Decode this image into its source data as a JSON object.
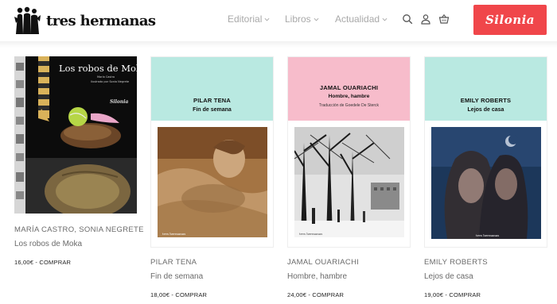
{
  "brand": {
    "name": "tres hermanas",
    "logo_icon": "three-sisters-silhouette"
  },
  "nav": [
    {
      "label": "Editorial"
    },
    {
      "label": "Libros"
    },
    {
      "label": "Actualidad"
    }
  ],
  "header_icons": [
    "search-icon",
    "user-icon",
    "cart-icon"
  ],
  "partner_button": {
    "label": "Silonia",
    "color": "#f0464a"
  },
  "books": [
    {
      "cover_title": "Los robos de Moka",
      "cover_subtitle_1": "María Castro",
      "cover_subtitle_2": "ilustrado por Sonia Negrete",
      "cover_sign": "Silonia",
      "author": "MARÍA CASTRO, SONIA NEGRETE",
      "title": "Los robos de Moka",
      "price": "16,00€ - COMPRAR"
    },
    {
      "cover_author": "PILAR TENA",
      "cover_title": "Fin de semana",
      "cover_color": "#b9e9e1",
      "author": "PILAR TENA",
      "title": "Fin de semana",
      "price": "18,00€ - COMPRAR"
    },
    {
      "cover_author": "JAMAL OUARIACHI",
      "cover_title": "Hombre, hambre",
      "cover_translator": "Traducción de Goedele De Sterck",
      "cover_color": "#f7bccb",
      "author": "JAMAL OUARIACHI",
      "title": "Hombre, hambre",
      "price": "24,00€ - COMPRAR"
    },
    {
      "cover_author": "EMILY ROBERTS",
      "cover_title": "Lejos de casa",
      "cover_color": "#b9e9e1",
      "author": "EMILY ROBERTS",
      "title": "Lejos de casa",
      "price": "19,00€ - COMPRAR"
    }
  ],
  "cover_publisher_mark": "tres hermanas"
}
